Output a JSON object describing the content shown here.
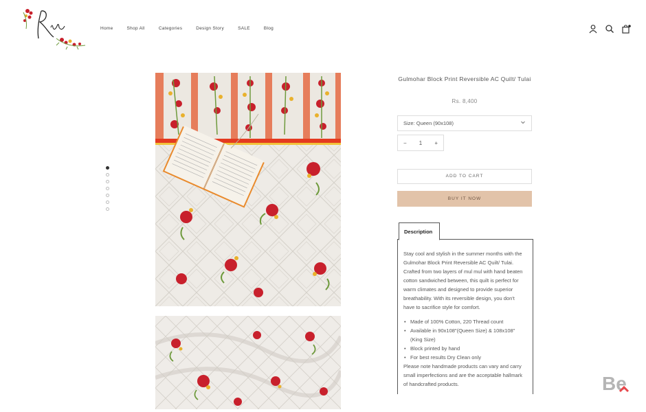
{
  "brand": {
    "logo_text": "Rikaa"
  },
  "nav": {
    "items": [
      "Home",
      "Shop All",
      "Categories",
      "Design Story",
      "SALE",
      "Blog"
    ]
  },
  "icons": [
    "user-icon",
    "search-icon",
    "bag-icon"
  ],
  "gallery": {
    "dot_count": 7,
    "active_index": 0
  },
  "product": {
    "title": "Gulmohar Block Print Reversible AC Quilt/ Tulai",
    "price": "Rs. 8,400",
    "size_label": "Size: Queen (90x108)",
    "quantity": "1",
    "qty_minus": "−",
    "qty_plus": "+",
    "add_to_cart": "ADD TO CART",
    "buy_now": "BUY IT NOW"
  },
  "description": {
    "tab_label": "Description",
    "paragraph": "Stay cool and stylish in the summer months with the Gulmohar Block Print Reversible AC Quilt/ Tulai. Crafted from two layers of mul mul with hand beaten cotton sandwiched between, this quilt is perfect for warm climates and designed to provide superior breathability. With its reversible design, you don't have to sacrifice style for comfort.",
    "bullets": [
      "Made of 100% Cotton, 220 Thread count",
      "Available in 90x108\"(Queen Size) & 108x108\" (King Size)",
      "Block printed by hand",
      "For best results Dry Clean only"
    ],
    "note": "Please note handmade products can vary and carry small imperfections and are the acceptable hallmark of handcrafted products."
  },
  "colors": {
    "accent": "#e2c3a9",
    "flower_red": "#c8202c",
    "flower_yellow": "#e9b12d",
    "leaf": "#6e9a3c"
  },
  "badge": {
    "text": "Be"
  }
}
